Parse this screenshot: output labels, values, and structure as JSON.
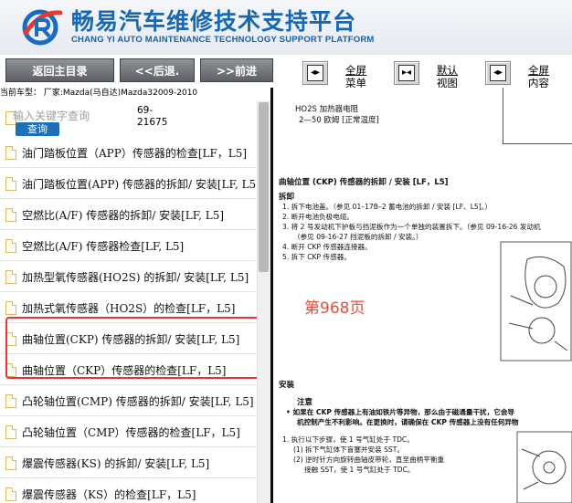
{
  "header": {
    "brand_cn": "畅易汽车维修技术支持平台",
    "brand_en": "CHANG YI AUTO MAINTENANCE TECHNOLOGY SUPPORT PLATFORM",
    "logo_icon": "cy-logo-icon",
    "accent_color": "#1468b5"
  },
  "toolbar": {
    "home_label": "返回主目录",
    "back_label": "<<后退.",
    "forward_label": ">>前进",
    "menu_full_1": "全屏",
    "menu_full_2": "菜单",
    "default_view_1": "默认",
    "default_view_2": "视图",
    "content_full_1": "全屏",
    "content_full_2": "内容"
  },
  "car": {
    "text": "当前车型：  厂家:Mazda(马自达)Mazda32009-2010"
  },
  "search": {
    "placeholder": "输入关键字查询",
    "button": "查询",
    "count_1": "69-",
    "count_2": "21675"
  },
  "items": [
    "油门踏板位置（APP）传感器的检查[LF，L5]",
    "油门踏板位置(APP) 传感器的拆卸/ 安装[LF, L5]",
    "空燃比(A/F) 传感器的拆卸/ 安装[LF, L5]",
    "空燃比(A/F) 传感器检查[LF, L5]",
    "加热型氧传感器(HO2S) 的拆卸/ 安装[LF, L5]",
    "加热式氧传感器（HO2S）的检查[LF，L5]",
    "曲轴位置(CKP) 传感器的拆卸/ 安装[LF, L5]",
    "曲轴位置（CKP）传感器的检查[LF，L5]",
    "凸轮轴位置(CMP) 传感器的拆卸/ 安装[LF, L5]",
    "凸轮轴位置（CMP）传感器的检查[LF，L5]",
    "爆震传感器(KS) 的拆卸/ 安装[LF, L5]",
    "爆震传感器（KS）的检查[LF，L5]"
  ],
  "doc": {
    "h1": "HO2S 加热器电阻",
    "h1b": "2—50 欧姆 [正常温度]",
    "title": "曲轴位置 (CKP) 传感器的拆卸 / 安装 [LF，L5]",
    "remove": "拆卸",
    "s1": "1.  拆下电池盖。（参见 01–17B–2 蓄电池的拆卸 / 安装 [LF、L5]。）",
    "s2": "2.  断开电池负极电缆。",
    "s3": "3.  将 2 号发动机下护板与挡泥板作为一个单独的装置拆下。（参见 09-16-26 发动机",
    "s3b": "（参见 09-16-27 挡泥板的拆卸 / 安装。）",
    "s4": "4.  断开 CKP 传感器连接器。",
    "s5": "5.  拆下 CKP 传感器。",
    "page": "第968页",
    "install": "安装",
    "note": "注意",
    "n1": "•  如果在 CKP 传感器上有油如铁片等异物，那么由于磁通量干扰，它会导",
    "n1b": "机控制产生不利影响。在更换时，请确保在 CKP 传感器上没有任何异物",
    "i1": "1.  执行以下步骤，使 1 号气缸处于 TDC。",
    "i1a": "(1)  拆下气缸体下盲塞并安装 SST。",
    "i1b": "(2)  逆时针方向旋转曲轴皮带轮，直至曲柄平衡重",
    "i1c": "接触 SST，使 1 号气缸处于 TDC。"
  }
}
